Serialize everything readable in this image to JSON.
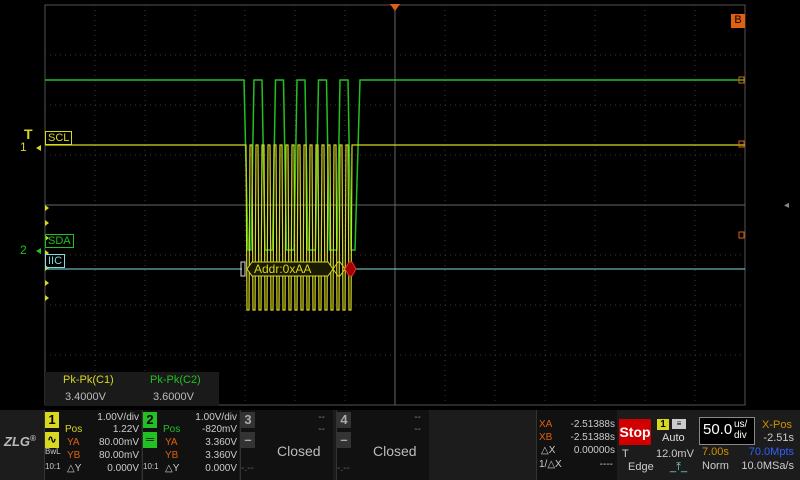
{
  "markers": {
    "trigger_T": "T",
    "ch1": "1",
    "ch2": "2",
    "right_B": "B"
  },
  "trace_labels": {
    "scl": "SCL",
    "sda": "SDA",
    "iic": "IIC"
  },
  "decode": {
    "packet": "Addr:0xAA"
  },
  "measurements": {
    "h1": "Pk-Pk(C1)",
    "h2": "Pk-Pk(C2)",
    "v1": "3.4000V",
    "v2": "3.6000V"
  },
  "colors": {
    "ch1": "#d8d820",
    "ch2": "#22c022",
    "iic": "#7fdede",
    "grid": "#3a3a3a",
    "stop": "#d00000"
  },
  "ch1_panel": {
    "num": "1",
    "vdiv": "1.00V/div",
    "pos_label": "Pos",
    "pos": "1.22V",
    "ya_label": "YA",
    "ya": "80.00mV",
    "yb_label": "YB",
    "yb": "80.00mV",
    "dy_label": "△Y",
    "dy": "0.000V",
    "bw": "BwL",
    "probe": "10:1"
  },
  "ch2_panel": {
    "num": "2",
    "vdiv": "1.00V/div",
    "pos_label": "Pos",
    "pos": "-820mV",
    "ya_label": "YA",
    "ya": "3.360V",
    "yb_label": "YB",
    "yb": "3.360V",
    "dy_label": "△Y",
    "dy": "0.000V",
    "probe": "10:1"
  },
  "ch3_panel": {
    "num": "3",
    "status": "Closed",
    "dashes": "--",
    "dash2": "--",
    "dash3": "-.--"
  },
  "ch4_panel": {
    "num": "4",
    "status": "Closed",
    "dashes": "--",
    "dash2": "--",
    "dash3": "-.--"
  },
  "cursor_panel": {
    "xa_label": "XA",
    "xa": "-2.51388s",
    "xb_label": "XB",
    "xb": "-2.51388s",
    "dx_label": "△X",
    "dx": "0.00000s",
    "inv_label": "1/△X",
    "inv": "----"
  },
  "run": {
    "stop": "Stop"
  },
  "trigger": {
    "src": "1",
    "mode": "Auto",
    "t_label": "T",
    "level": "12.0mV",
    "type": "Edge"
  },
  "timebase": {
    "value": "50.0",
    "unit_top": "us/",
    "unit_bot": "div",
    "xpos_label": "X-Pos",
    "xpos": "-2.51s",
    "time": "7.00s",
    "mpts": "70.0Mpts",
    "mode": "Norm",
    "rate": "10.0MSa/s"
  },
  "brand": {
    "logo": "ZLG"
  }
}
